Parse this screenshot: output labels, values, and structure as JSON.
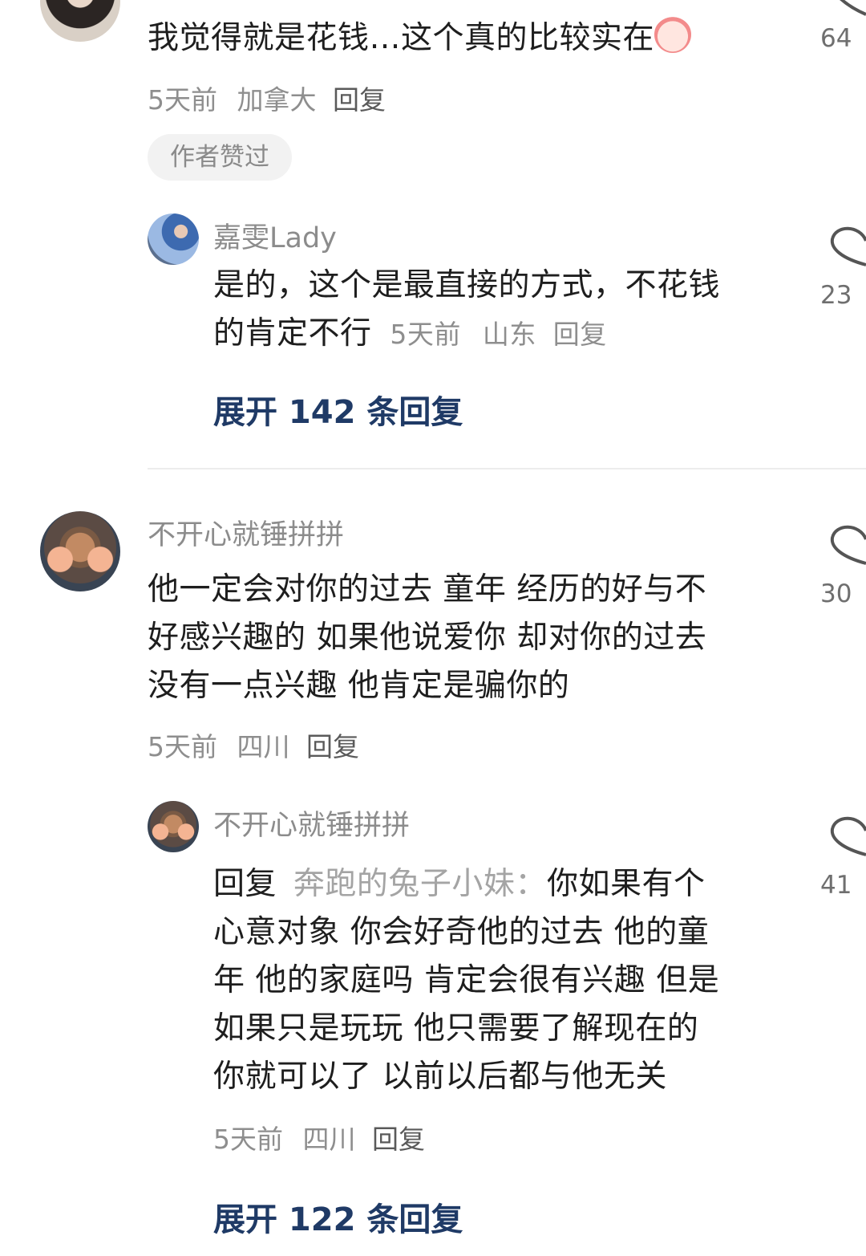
{
  "comments": [
    {
      "text": "我觉得就是花钱…这个真的比较实在",
      "emoji": "crying-face-icon",
      "meta": {
        "time": "5天前",
        "location": "加拿大",
        "reply": "回复"
      },
      "badge": "作者赞过",
      "likes": "64",
      "replies": [
        {
          "user": "嘉雯Lady",
          "text_line1": "是的，这个是最直接的方式，不花钱",
          "text_line2": "的肯定不行",
          "meta": {
            "time": "5天前",
            "location": "山东",
            "reply": "回复"
          },
          "likes": "23"
        }
      ],
      "expand": "展开 142 条回复"
    },
    {
      "user": "不开心就锤拼拼",
      "lines": [
        "他一定会对你的过去 童年 经历的好与不",
        "好感兴趣的 如果他说爱你 却对你的过去",
        "没有一点兴趣 他肯定是骗你的"
      ],
      "meta": {
        "time": "5天前",
        "location": "四川",
        "reply": "回复"
      },
      "likes": "30",
      "replies": [
        {
          "user": "不开心就锤拼拼",
          "reply_prefix": "回复",
          "reply_to": "奔跑的兔子小妹：",
          "line1_rest": "你如果有个",
          "lines": [
            "心意对象 你会好奇他的过去 他的童",
            "年 他的家庭吗 肯定会很有兴趣 但是",
            "如果只是玩玩 他只需要了解现在的",
            "你就可以了 以前以后都与他无关"
          ],
          "meta": {
            "time": "5天前",
            "location": "四川",
            "reply": "回复"
          },
          "likes": "41"
        }
      ],
      "expand": "展开 122 条回复"
    }
  ]
}
